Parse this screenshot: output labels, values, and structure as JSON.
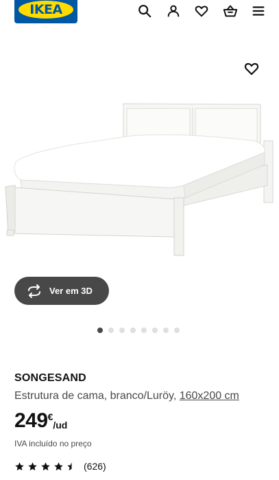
{
  "header": {
    "logo_text": "IKEA",
    "icons": [
      "search-icon",
      "user-icon",
      "heart-icon",
      "basket-icon",
      "menu-icon"
    ]
  },
  "gallery": {
    "view_3d_label": "Ver em 3D",
    "dot_count": 8,
    "active_dot": 1
  },
  "product": {
    "name": "SONGESAND",
    "description": "Estrutura de cama, branco/Luröy, ",
    "size": "160x200 cm",
    "price_integer": "249",
    "currency": "€",
    "unit": "/ud",
    "vat_note": "IVA incluído no preço",
    "rating_value": 4.5,
    "review_count": "(626)"
  },
  "colors": {
    "brand_blue": "#0058a3",
    "brand_yellow": "#ffdb00",
    "button_dark": "#484848"
  }
}
